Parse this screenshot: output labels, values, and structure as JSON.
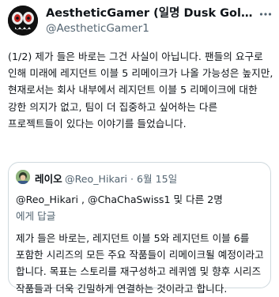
{
  "tweet": {
    "author": {
      "display_name": "AestheticGamer (일명 Dusk Gol…",
      "handle": "@AestheticGamer1"
    },
    "text": "(1/2) 제가 들은 바로는 그건 사실이 아닙니다. 팬들의 요구로 인해 미래에 레지던트 이블 5 리메이크가 나올 가능성은 높지만, 현재로서는 회사 내부에서 레지던트 이블 5 리메이크에 대한 강한 의지가 없고, 팀이 더 집중하고 싶어하는 다른 프로젝트들이 있다는 이야기를 들었습니다."
  },
  "quote": {
    "author_name": "레이오",
    "meta": "@Reo_Hikari · 6월 15일",
    "reply_line": "@Reo_Hikari , @ChaChaSwiss1 및 다른 2명",
    "reply_suffix": "에게 답글",
    "text": "제가 들은 바로는, 레지던트 이블 5와 레지던트 이블 6를 포함한 시리즈의 모든 주요 작품들이 리메이크될 예정이라고 합니다. 목표는 스토리를 재구성하고 레퀴엠 및 향후 시리즈 작품들과 더욱 긴밀하게 연결하는 것이라고 합니다."
  },
  "icons": {
    "more": "more-horizontal-icon",
    "avatar": "demon-face-avatar",
    "quote_avatar": "character-avatar"
  },
  "colors": {
    "text": "#0f1419",
    "secondary": "#536471",
    "border": "#cfd9de",
    "link": "#1d9bf0"
  }
}
